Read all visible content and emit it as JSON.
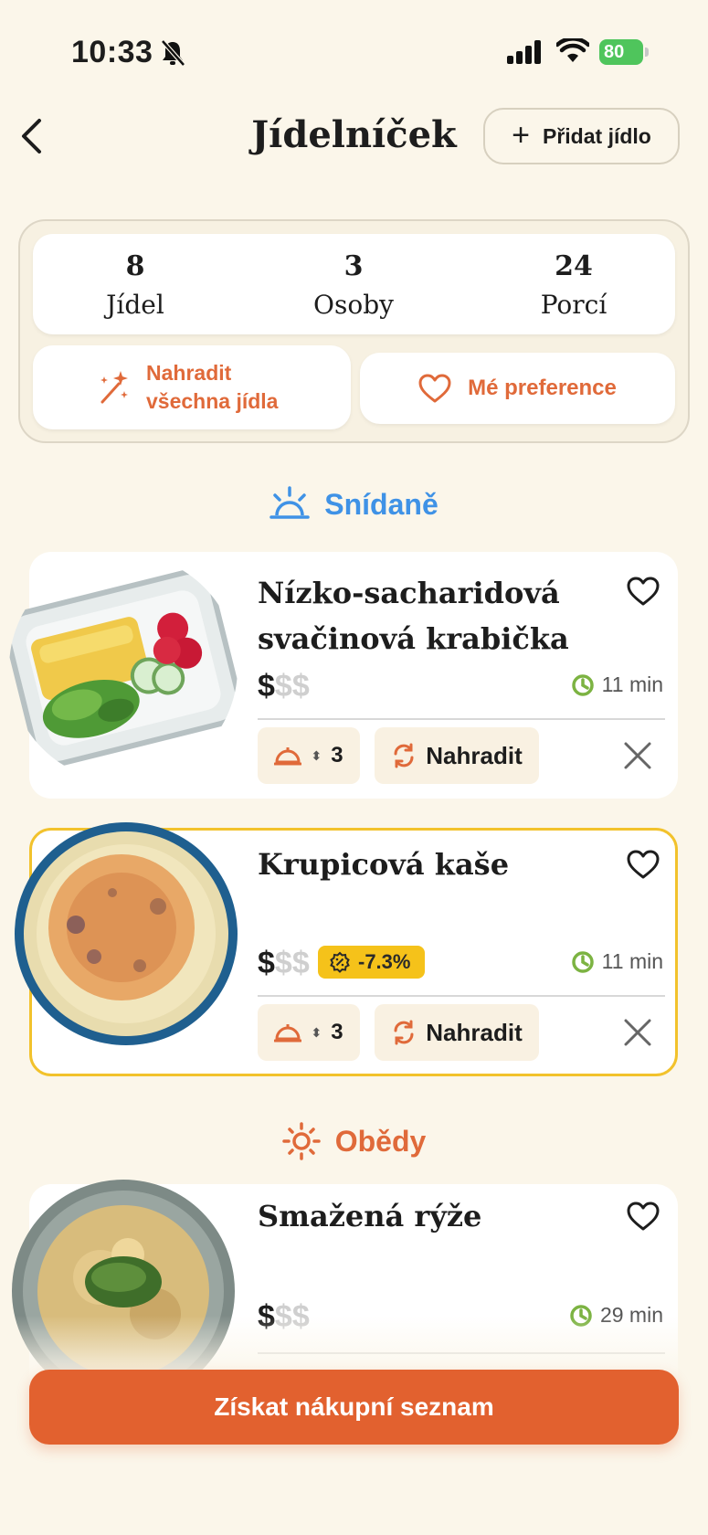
{
  "status_bar": {
    "time": "10:33",
    "battery": "80",
    "icons": [
      "bell-slash-icon",
      "signal-icon",
      "wifi-icon",
      "battery-icon"
    ]
  },
  "header": {
    "title": "Jídelníček",
    "add_meal_label": "Přidat jídlo"
  },
  "summary": {
    "stats": [
      {
        "value": "8",
        "label": "Jídel"
      },
      {
        "value": "3",
        "label": "Osoby"
      },
      {
        "value": "24",
        "label": "Porcí"
      }
    ],
    "replace_all_line1": "Nahradit",
    "replace_all_line2": "všechna jídla",
    "preferences_label": "Mé preference"
  },
  "sections": {
    "breakfast": "Snídaně",
    "lunch": "Obědy"
  },
  "meals": [
    {
      "title_line1": "Nízko-sacharidová",
      "title_line2": "svačinová krabička",
      "price_active": "$",
      "price_inactive": "$$",
      "time": "11 min",
      "servings": "3",
      "replace_label": "Nahradit"
    },
    {
      "title_line1": "Krupicová kaše",
      "price_active": "$",
      "price_inactive": "$$",
      "discount": "-7.3%",
      "time": "11 min",
      "servings": "3",
      "replace_label": "Nahradit"
    },
    {
      "title_line1": "Smažená rýže",
      "price_active": "$",
      "price_inactive": "$$",
      "time": "29 min"
    }
  ],
  "cta": {
    "shopping_list_label": "Získat nákupní seznam"
  },
  "colors": {
    "background": "#fbf6ea",
    "accent_orange": "#e06a3a",
    "breakfast_blue": "#3f92e6",
    "discount_yellow": "#f5c21a",
    "time_green": "#7cb342",
    "cta": "#e2612f"
  }
}
